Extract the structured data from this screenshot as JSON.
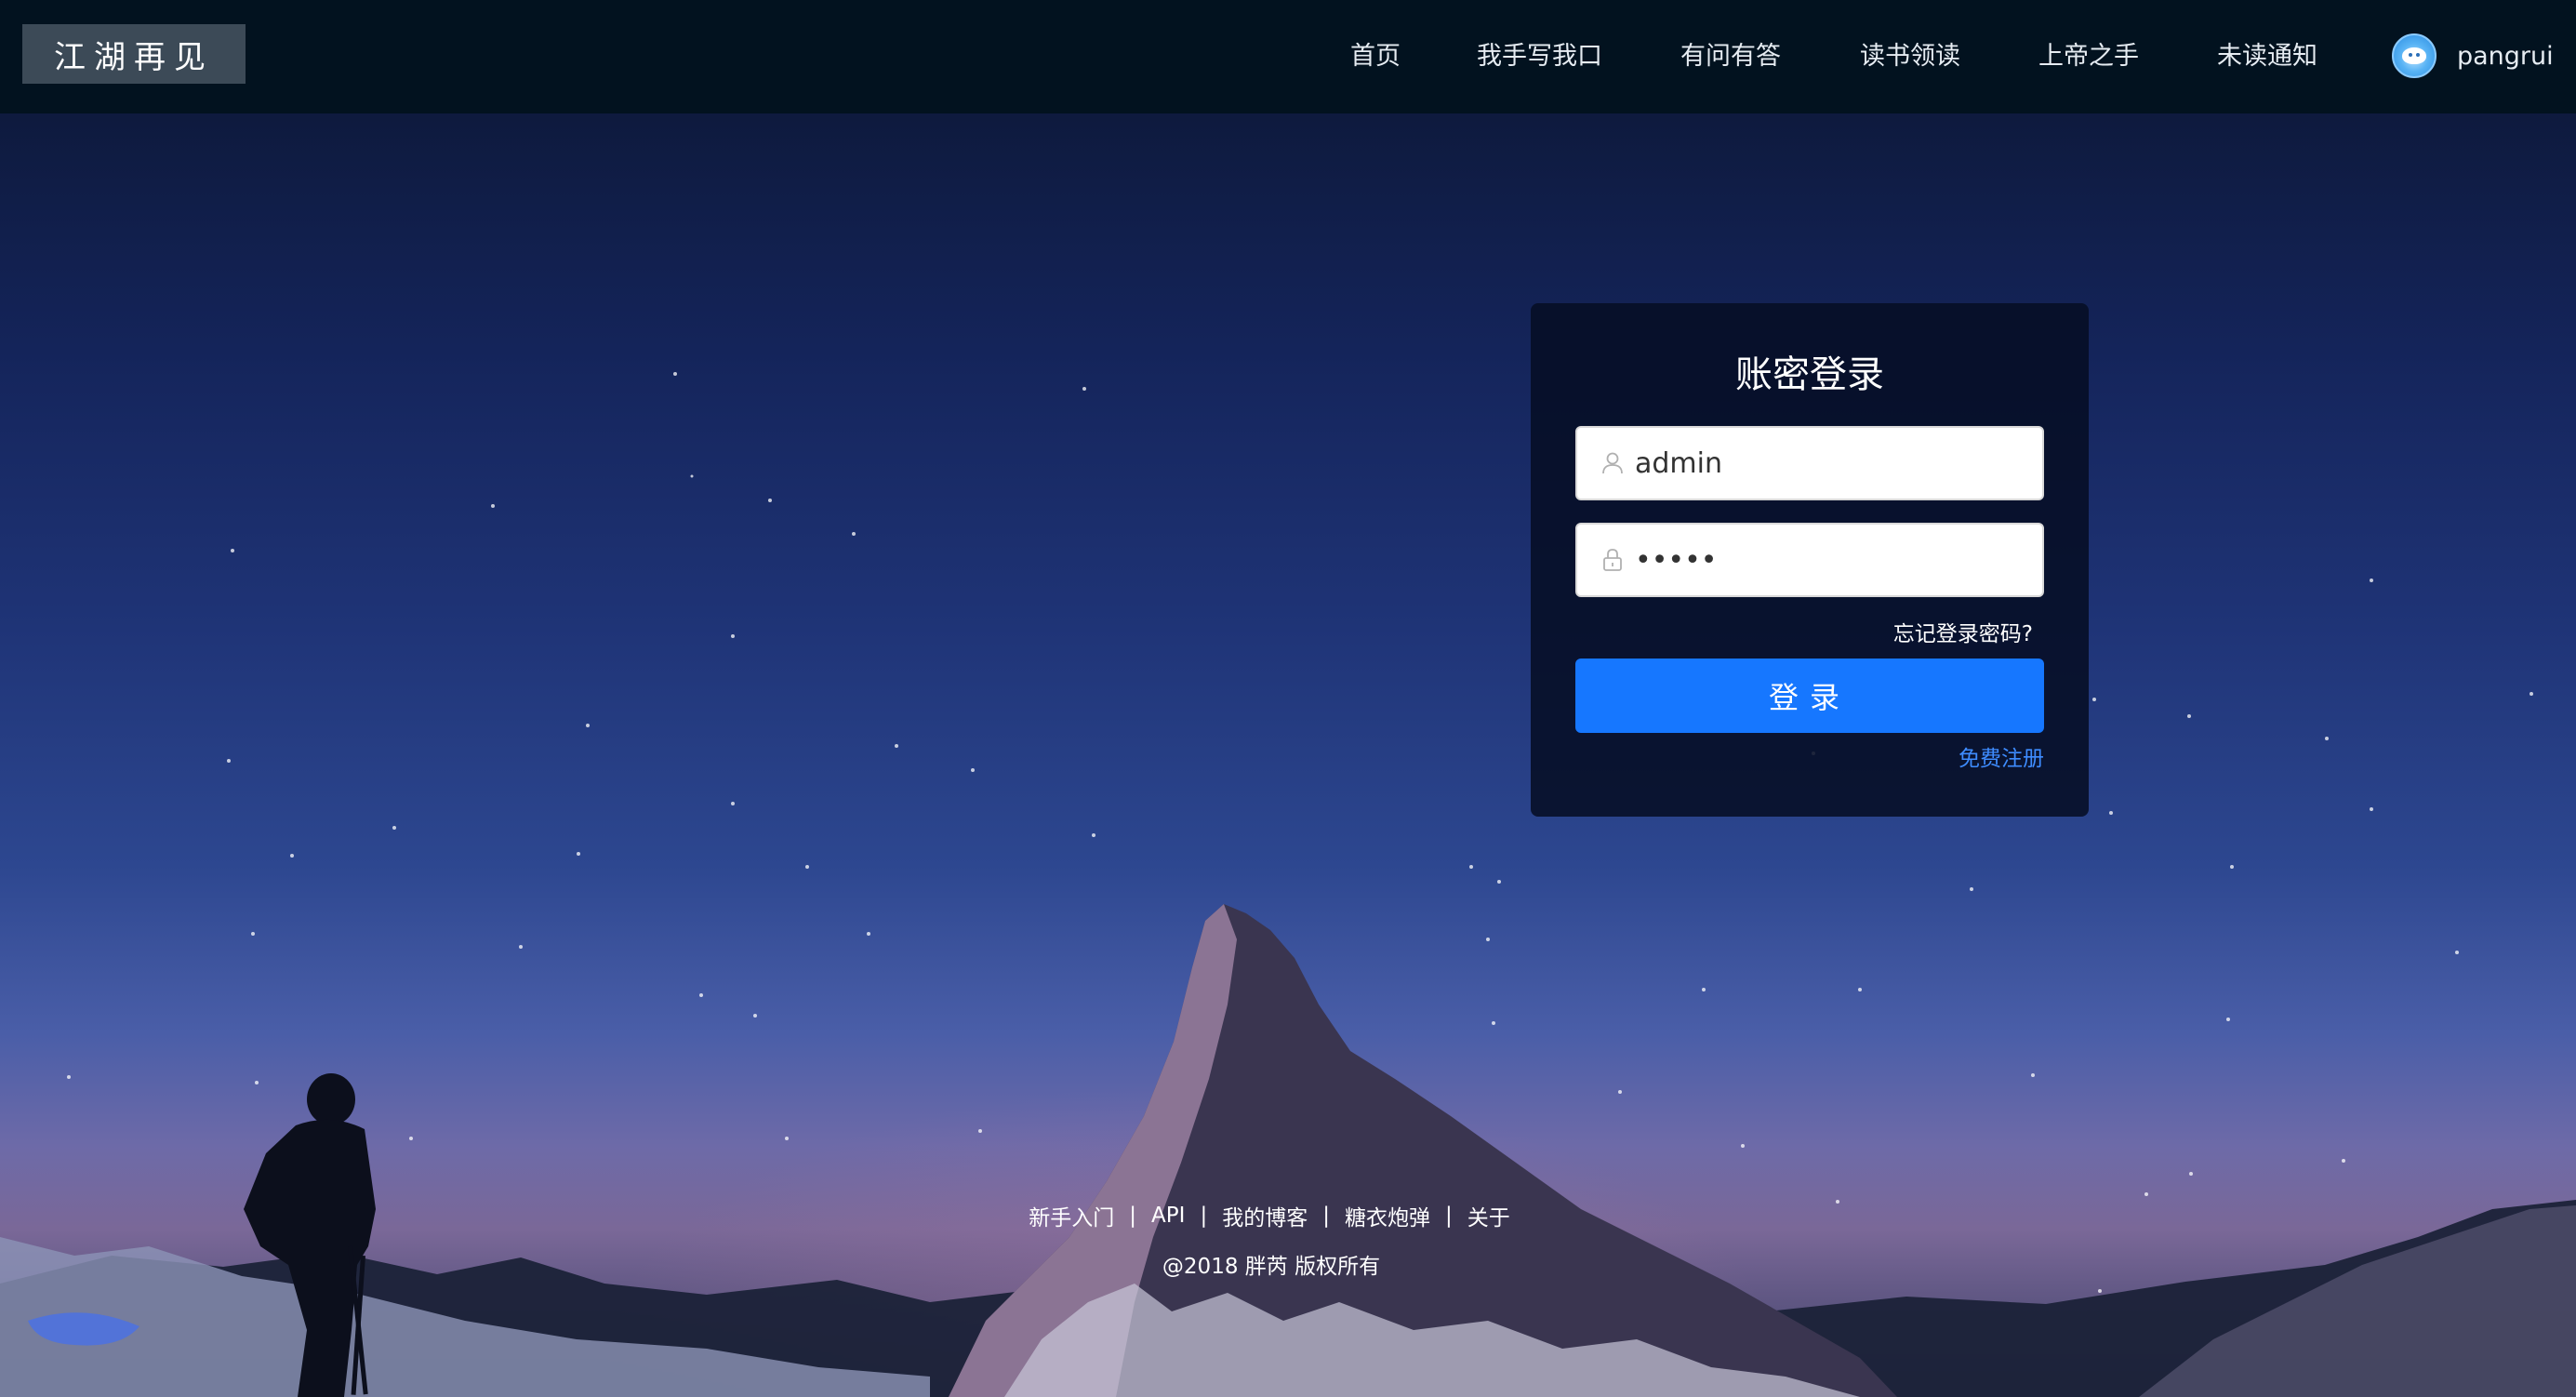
{
  "header": {
    "logo": "江湖再见",
    "nav": [
      {
        "label": "首页"
      },
      {
        "label": "我手写我口"
      },
      {
        "label": "有问有答"
      },
      {
        "label": "读书领读"
      },
      {
        "label": "上帝之手"
      },
      {
        "label": "未读通知"
      }
    ],
    "user": {
      "name": "pangrui",
      "avatar_icon": "avatar-icon"
    }
  },
  "login": {
    "title": "账密登录",
    "username_value": "admin",
    "password_value": "•••••",
    "user_icon": "user-icon",
    "lock_icon": "lock-icon",
    "forgot_label": "忘记登录密码?",
    "submit_label": "登录",
    "register_label": "免费注册"
  },
  "footer": {
    "links": [
      "新手入门",
      "API",
      "我的博客",
      "糖衣炮弹",
      "关于"
    ],
    "separator": "|",
    "copyright": "@2018 胖芮 版权所有"
  },
  "colors": {
    "header_bg": "#02121f",
    "primary": "#1677ff",
    "link": "#3e8cff"
  }
}
